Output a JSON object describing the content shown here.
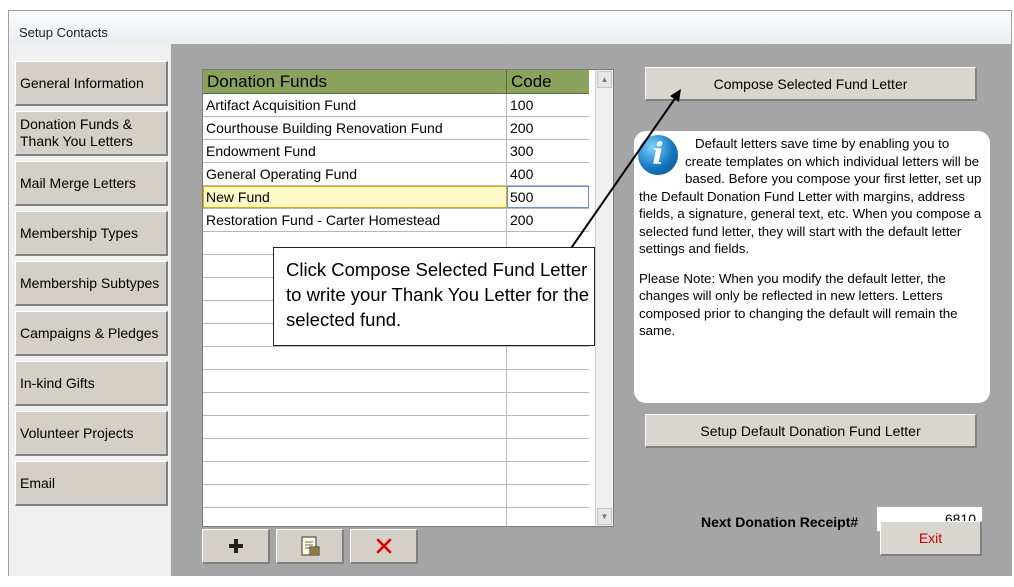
{
  "window": {
    "title": "Setup Contacts"
  },
  "sidebar": {
    "items": [
      {
        "label": "General Information"
      },
      {
        "label": "Donation Funds & Thank You Letters"
      },
      {
        "label": "Mail Merge Letters"
      },
      {
        "label": "Membership Types"
      },
      {
        "label": "Membership Subtypes"
      },
      {
        "label": "Campaigns & Pledges"
      },
      {
        "label": "In-kind Gifts"
      },
      {
        "label": "Volunteer Projects"
      },
      {
        "label": "Email"
      }
    ]
  },
  "grid": {
    "columns": [
      "Donation Funds",
      "Code"
    ],
    "rows": [
      {
        "name": "Artifact Acquisition Fund",
        "code": "100"
      },
      {
        "name": "Courthouse Building Renovation Fund",
        "code": "200"
      },
      {
        "name": "Endowment Fund",
        "code": "300"
      },
      {
        "name": "General Operating Fund",
        "code": "400"
      },
      {
        "name": "New Fund",
        "code": "500"
      },
      {
        "name": "Restoration Fund - Carter Homestead",
        "code": "200"
      }
    ],
    "selected_row": "New Fund"
  },
  "toolbar": {
    "add_icon": "plus-icon",
    "edit_icon": "document-edit-icon",
    "delete_icon": "red-x-icon"
  },
  "buttons": {
    "compose": "Compose Selected Fund Letter",
    "setup_default": "Setup Default Donation Fund Letter",
    "exit": "Exit"
  },
  "info": {
    "paragraph1": "Default letters save time by enabling you to create templates on which individual letters will be based. Before you compose your first letter, set up the Default Donation Fund Letter with margins, address fields, a signature, general text, etc. When you compose a selected fund letter, they will start with the default letter settings and fields.",
    "paragraph2": "Please Note:  When you modify the default letter, the changes will only be reflected in new letters. Letters composed prior to changing the default will remain the same."
  },
  "callout": {
    "text": "Click Compose Selected Fund Letter to write your Thank You Letter for the selected fund."
  },
  "receipt": {
    "label": "Next Donation Receipt#",
    "value": "6810"
  },
  "colors": {
    "grid_header": "#8aa35c",
    "content_bg": "#a5a5a5",
    "exit_text": "#cc0000",
    "delete_x": "#dd0000"
  }
}
